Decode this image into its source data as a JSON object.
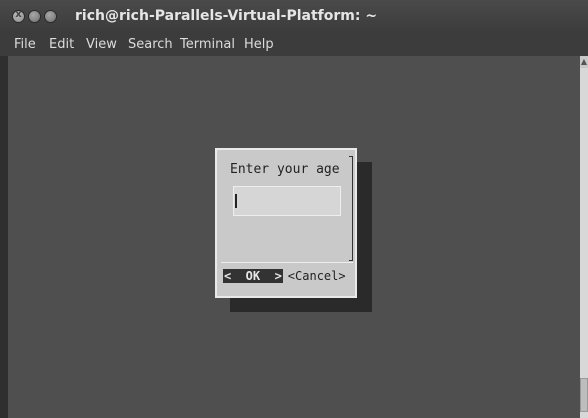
{
  "window": {
    "title": "rich@rich-Parallels-Virtual-Platform: ~",
    "close_glyph": "x"
  },
  "menubar": {
    "items": [
      "File",
      "Edit",
      "View",
      "Search",
      "Terminal",
      "Help"
    ]
  },
  "dialog": {
    "prompt": "Enter your age",
    "input_value": "",
    "ok_label": "<  OK  >",
    "cancel_label": "<Cancel>"
  }
}
